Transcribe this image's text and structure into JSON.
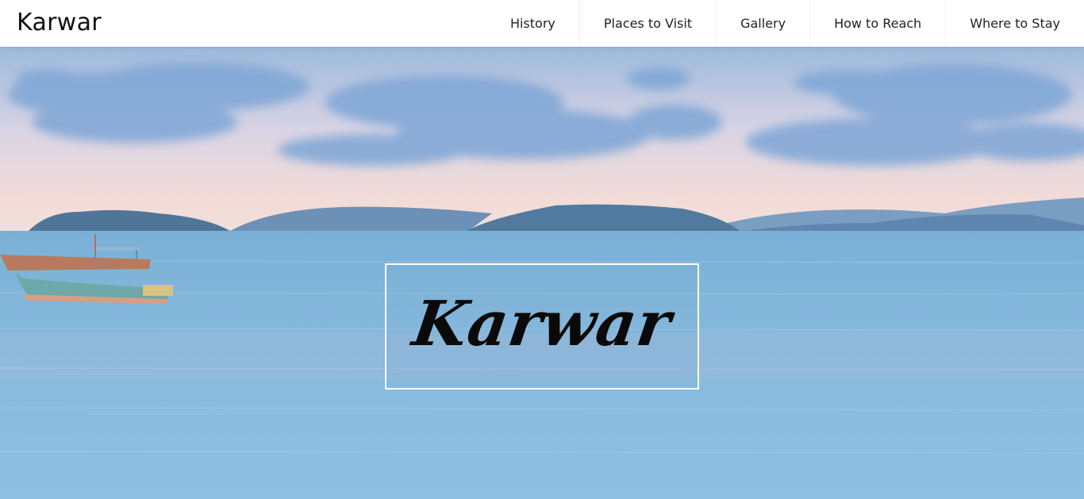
{
  "navbar": {
    "brand": "Karwar",
    "items": [
      {
        "label": "History"
      },
      {
        "label": "Places to Visit"
      },
      {
        "label": "Gallery"
      },
      {
        "label": "How to Reach"
      },
      {
        "label": "Where to Stay"
      }
    ]
  },
  "hero": {
    "title": "Karwar",
    "colors": {
      "sky_top": "#8fb3d9",
      "sky_horizon": "#f2dcd8",
      "sea": "#7fb2d6",
      "hills": "#5f87ab"
    }
  }
}
